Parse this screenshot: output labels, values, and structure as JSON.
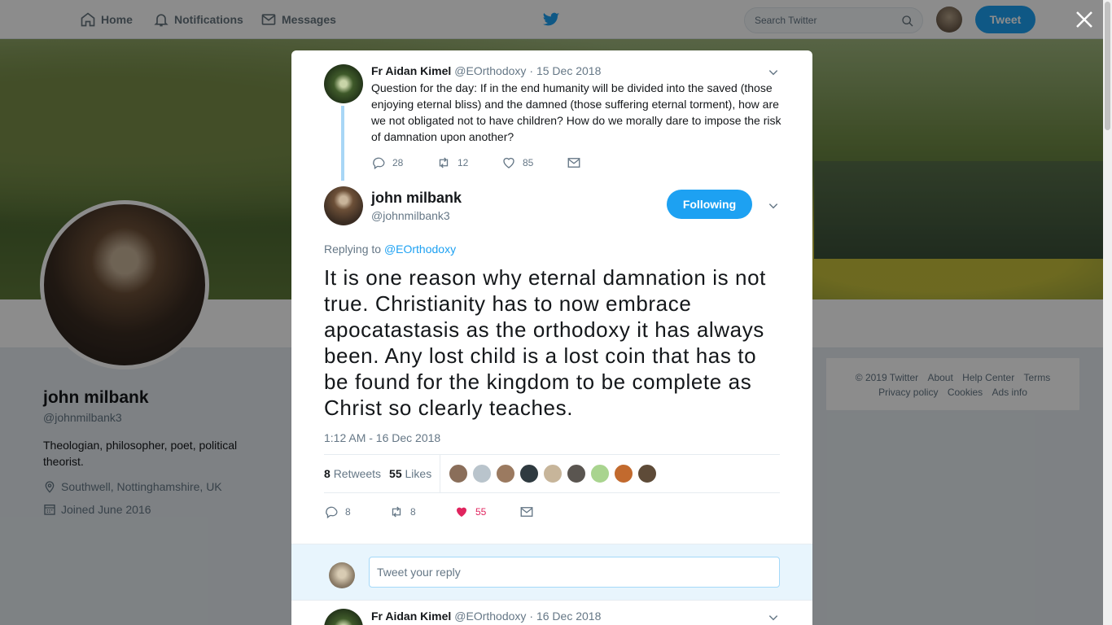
{
  "nav": {
    "home": "Home",
    "notifications": "Notifications",
    "messages": "Messages",
    "search_placeholder": "Search Twitter",
    "tweet_button": "Tweet"
  },
  "profile": {
    "name": "john milbank",
    "handle": "@johnmilbank3",
    "bio": "Theologian, philosopher, poet, political theorist.",
    "location": "Southwell, Nottinghamshire, UK",
    "joined": "Joined June 2016"
  },
  "footer": {
    "copyright": "© 2019 Twitter",
    "about": "About",
    "help": "Help Center",
    "terms": "Terms",
    "privacy": "Privacy policy",
    "cookies": "Cookies",
    "ads": "Ads info"
  },
  "parent_tweet": {
    "name": "Fr Aidan Kimel",
    "handle": "@EOrthodoxy",
    "date": "· 15 Dec 2018",
    "text": "Question for the day: If in the end humanity will be divided into the saved (those enjoying eternal bliss) and the damned (those suffering eternal torment), how are we not obligated not to have children? How do we morally dare to impose the risk of damnation upon another?",
    "replies": "28",
    "retweets": "12",
    "likes": "85"
  },
  "main_tweet": {
    "name": "john milbank",
    "handle": "@johnmilbank3",
    "follow_label": "Following",
    "replying_prefix": "Replying to",
    "replying_to": "@EOrthodoxy",
    "text": "It is one reason why eternal damnation is not true. Christianity has to now embrace apocatastasis as the orthodoxy it has always been. Any lost child is a lost coin that has to be found for the kingdom to be complete as Christ so clearly teaches.",
    "timestamp": "1:12 AM - 16 Dec 2018",
    "retweet_count": "8",
    "retweet_label": "Retweets",
    "like_count": "55",
    "like_label": "Likes",
    "replies": "8",
    "retweets": "8",
    "likes": "55",
    "likers": [
      "#8a6e5a",
      "#b9c4cc",
      "#9b7a60",
      "#2f3a40",
      "#c7b59a",
      "#5a5550",
      "#a9d48f",
      "#c26a2e",
      "#5e4b38"
    ]
  },
  "reply_box": {
    "placeholder": "Tweet your reply"
  },
  "next_tweet": {
    "name": "Fr Aidan Kimel",
    "handle": "@EOrthodoxy",
    "date": "· 16 Dec 2018"
  },
  "colors": {
    "accent": "#1da1f2",
    "like": "#e0245e",
    "muted": "#657786"
  }
}
